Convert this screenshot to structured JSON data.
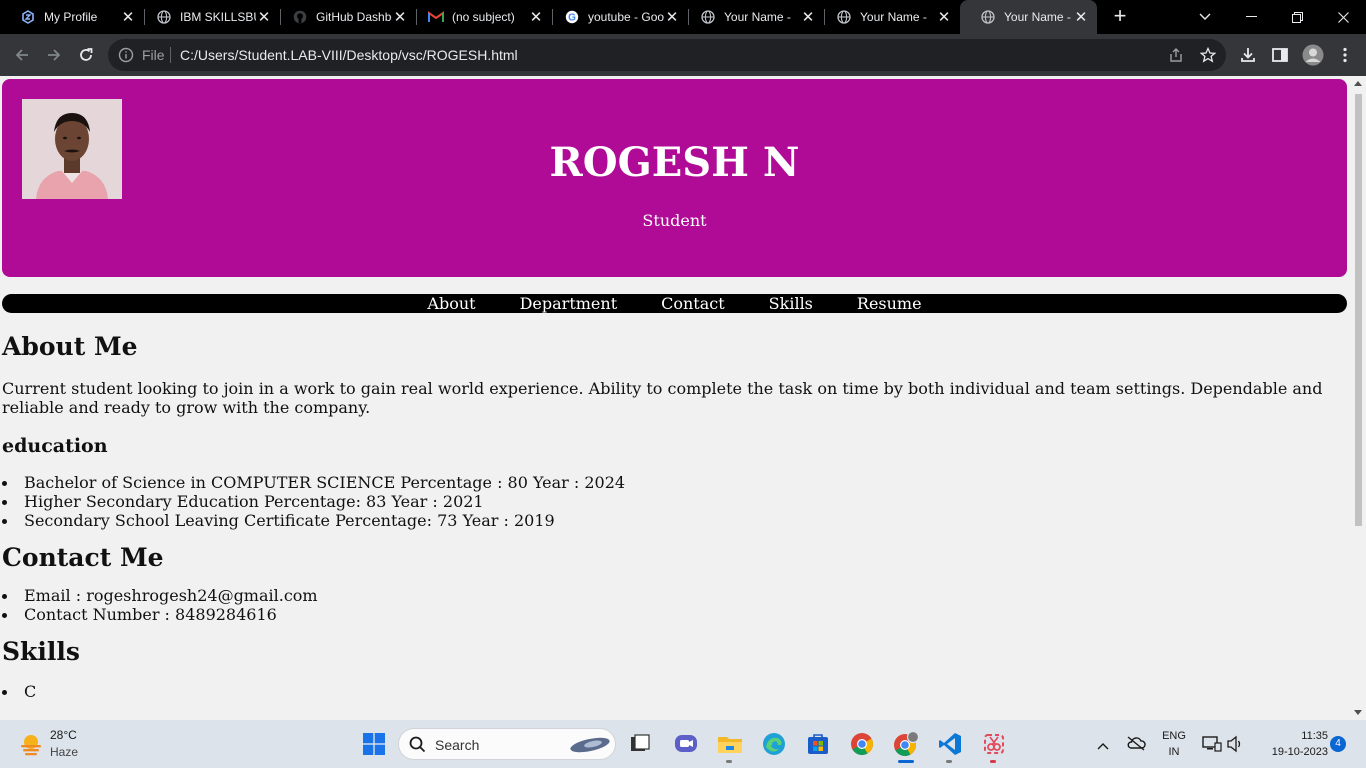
{
  "browser": {
    "tabs": [
      {
        "title": "My Profile",
        "icon": "skillsbuild-icon",
        "active": false
      },
      {
        "title": "IBM SKILLSBUILD",
        "icon": "globe-icon",
        "active": false
      },
      {
        "title": "GitHub Dashboard",
        "icon": "github-icon",
        "active": false
      },
      {
        "title": "(no subject)",
        "icon": "gmail-icon",
        "active": false
      },
      {
        "title": "youtube - Google",
        "icon": "google-icon",
        "active": false
      },
      {
        "title": "Your Name - ",
        "icon": "globe-icon",
        "active": false
      },
      {
        "title": "Your Name - ",
        "icon": "globe-icon",
        "active": false
      },
      {
        "title": "Your Name - ",
        "icon": "globe-icon",
        "active": true
      }
    ],
    "new_tab_label": "+",
    "omnibox": {
      "scheme_label": "File",
      "url": "C:/Users/Student.LAB-VIII/Desktop/vsc/ROGESH.html"
    }
  },
  "page": {
    "header": {
      "name": "ROGESH N",
      "role": "Student",
      "accent_color": "#b00b96"
    },
    "nav": [
      "About",
      "Department",
      "Contact",
      "Skills",
      "Resume"
    ],
    "about": {
      "heading": "About Me",
      "text": "Current student looking to join in a work to gain real world experience. Ability to complete the task on time by both individual and team settings. Dependable and reliable and ready to grow with the company."
    },
    "education": {
      "heading": "education",
      "items": [
        "Bachelor of Science in COMPUTER SCIENCE Percentage : 80 Year : 2024",
        "Higher Secondary Education Percentage: 83 Year : 2021",
        "Secondary School Leaving Certificate Percentage: 73 Year : 2019"
      ]
    },
    "contact": {
      "heading": "Contact Me",
      "items": [
        "Email : rogeshrogesh24@gmail.com",
        "Contact Number : 8489284616"
      ]
    },
    "skills": {
      "heading": "Skills",
      "items": [
        "C"
      ]
    }
  },
  "taskbar": {
    "weather": {
      "temp": "28°C",
      "desc": "Haze"
    },
    "search_placeholder": "Search",
    "language": {
      "line1": "ENG",
      "line2": "IN"
    },
    "clock": {
      "time": "11:35",
      "date": "19-10-2023"
    },
    "notifications": "4"
  }
}
